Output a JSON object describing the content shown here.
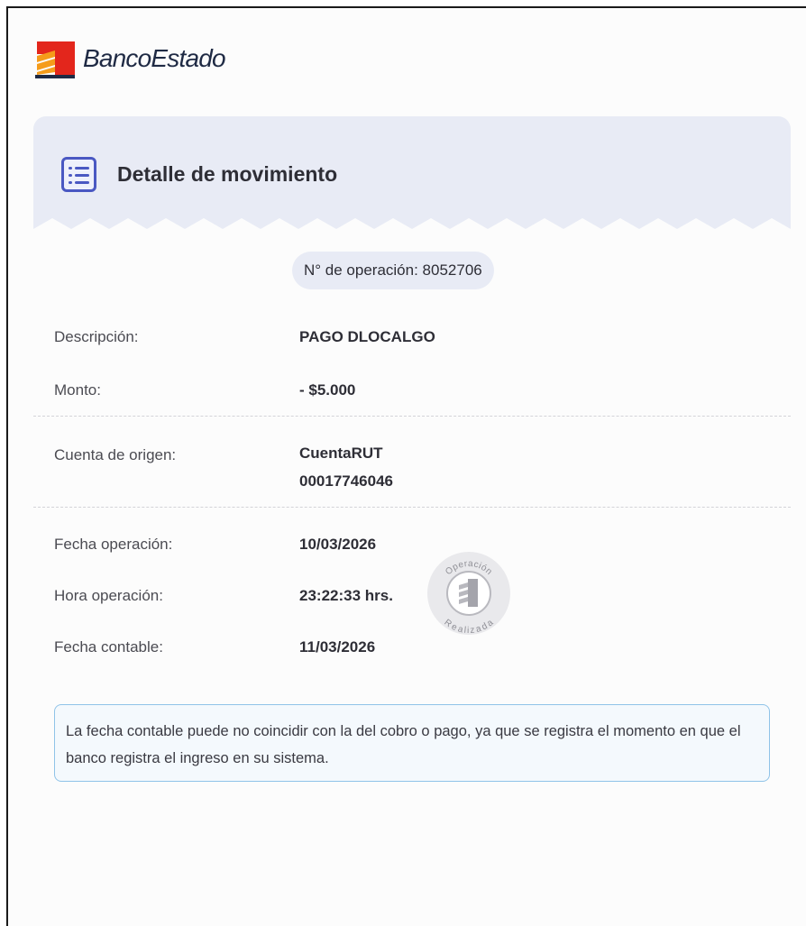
{
  "brand": {
    "name": "BancoEstado",
    "colors": {
      "red": "#e3261c",
      "orange": "#f59c1a",
      "navy": "#1f2a44"
    }
  },
  "header": {
    "icon": "list-icon",
    "title": "Detalle de movimiento"
  },
  "operation_pill": "N° de operación: 8052706",
  "details": {
    "descripcion": {
      "label": "Descripción:",
      "value": "PAGO DLOCALGO"
    },
    "monto": {
      "label": "Monto:",
      "value": "- $5.000"
    },
    "cuenta_origen": {
      "label": "Cuenta de origen:",
      "value_line1": "CuentaRUT",
      "value_line2": "00017746046"
    },
    "fecha_operacion": {
      "label": "Fecha operación:",
      "value": "10/03/2026"
    },
    "hora_operacion": {
      "label": "Hora operación:",
      "value": "23:22:33 hrs."
    },
    "fecha_contable": {
      "label": "Fecha contable:",
      "value": "11/03/2026"
    }
  },
  "stamp": {
    "top_text": "Operación",
    "bottom_text": "Realizada",
    "icon": "bank-logo-icon"
  },
  "note": "La fecha contable puede no coincidir con la del cobro o pago, ya que se registra el momento en que el banco registra el ingreso en su sistema.",
  "colors": {
    "accent": "#4a58c2",
    "header_bg": "#e8ebf5",
    "note_border": "#8fc3e8"
  }
}
